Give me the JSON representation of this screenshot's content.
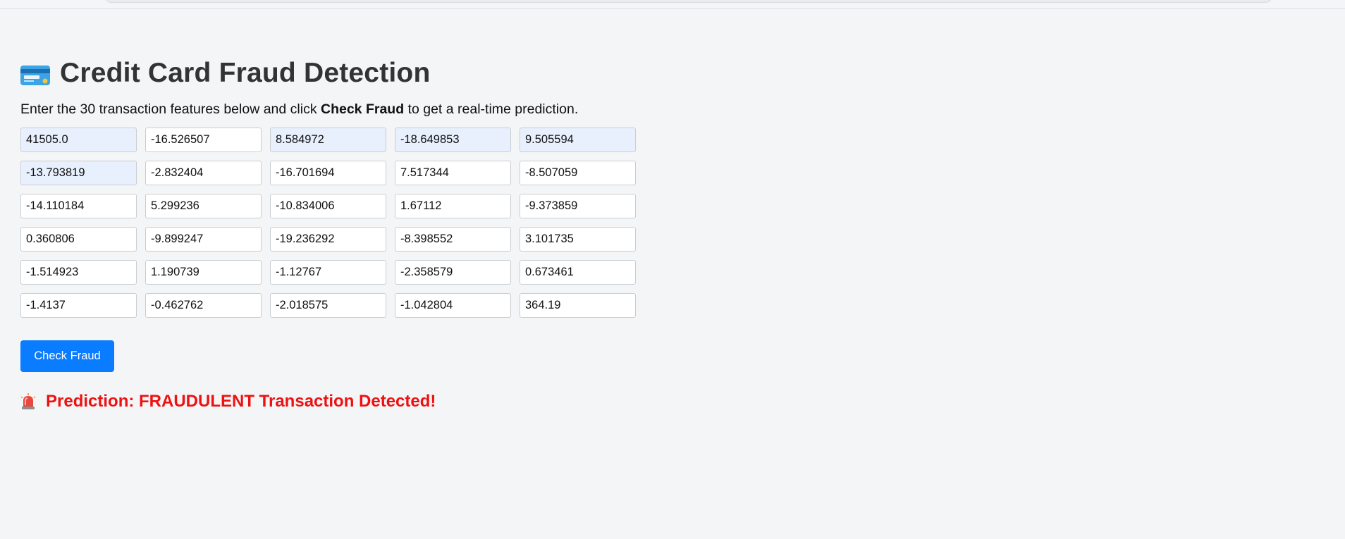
{
  "page": {
    "title": "Credit Card Fraud Detection",
    "subtitle_before": "Enter the 30 transaction features below and click ",
    "subtitle_bold": "Check Fraud",
    "subtitle_after": " to get a real-time prediction.",
    "title_icon": "credit-card-icon"
  },
  "features": [
    {
      "value": "41505.0",
      "autofilled": true
    },
    {
      "value": "-16.526507",
      "autofilled": false
    },
    {
      "value": "8.584972",
      "autofilled": true
    },
    {
      "value": "-18.649853",
      "autofilled": true
    },
    {
      "value": "9.505594",
      "autofilled": true
    },
    {
      "value": "-13.793819",
      "autofilled": true
    },
    {
      "value": "-2.832404",
      "autofilled": false
    },
    {
      "value": "-16.701694",
      "autofilled": false
    },
    {
      "value": "7.517344",
      "autofilled": false
    },
    {
      "value": "-8.507059",
      "autofilled": false
    },
    {
      "value": "-14.110184",
      "autofilled": false
    },
    {
      "value": "5.299236",
      "autofilled": false
    },
    {
      "value": "-10.834006",
      "autofilled": false
    },
    {
      "value": "1.67112",
      "autofilled": false
    },
    {
      "value": "-9.373859",
      "autofilled": false
    },
    {
      "value": "0.360806",
      "autofilled": false
    },
    {
      "value": "-9.899247",
      "autofilled": false
    },
    {
      "value": "-19.236292",
      "autofilled": false
    },
    {
      "value": "-8.398552",
      "autofilled": false
    },
    {
      "value": "3.101735",
      "autofilled": false
    },
    {
      "value": "-1.514923",
      "autofilled": false
    },
    {
      "value": "1.190739",
      "autofilled": false
    },
    {
      "value": "-1.12767",
      "autofilled": false
    },
    {
      "value": "-2.358579",
      "autofilled": false
    },
    {
      "value": "0.673461",
      "autofilled": false
    },
    {
      "value": "-1.4137",
      "autofilled": false
    },
    {
      "value": "-0.462762",
      "autofilled": false
    },
    {
      "value": "-2.018575",
      "autofilled": false
    },
    {
      "value": "-1.042804",
      "autofilled": false
    },
    {
      "value": "364.19",
      "autofilled": false
    }
  ],
  "button": {
    "label": "Check Fraud"
  },
  "prediction": {
    "text": "Prediction: FRAUDULENT Transaction Detected!",
    "icon": "alarm-icon"
  },
  "colors": {
    "background": "#f4f5f7",
    "title": "#333333",
    "accent": "#0a7cff",
    "danger": "#ee1111",
    "autofill": "#e8f0fe"
  }
}
